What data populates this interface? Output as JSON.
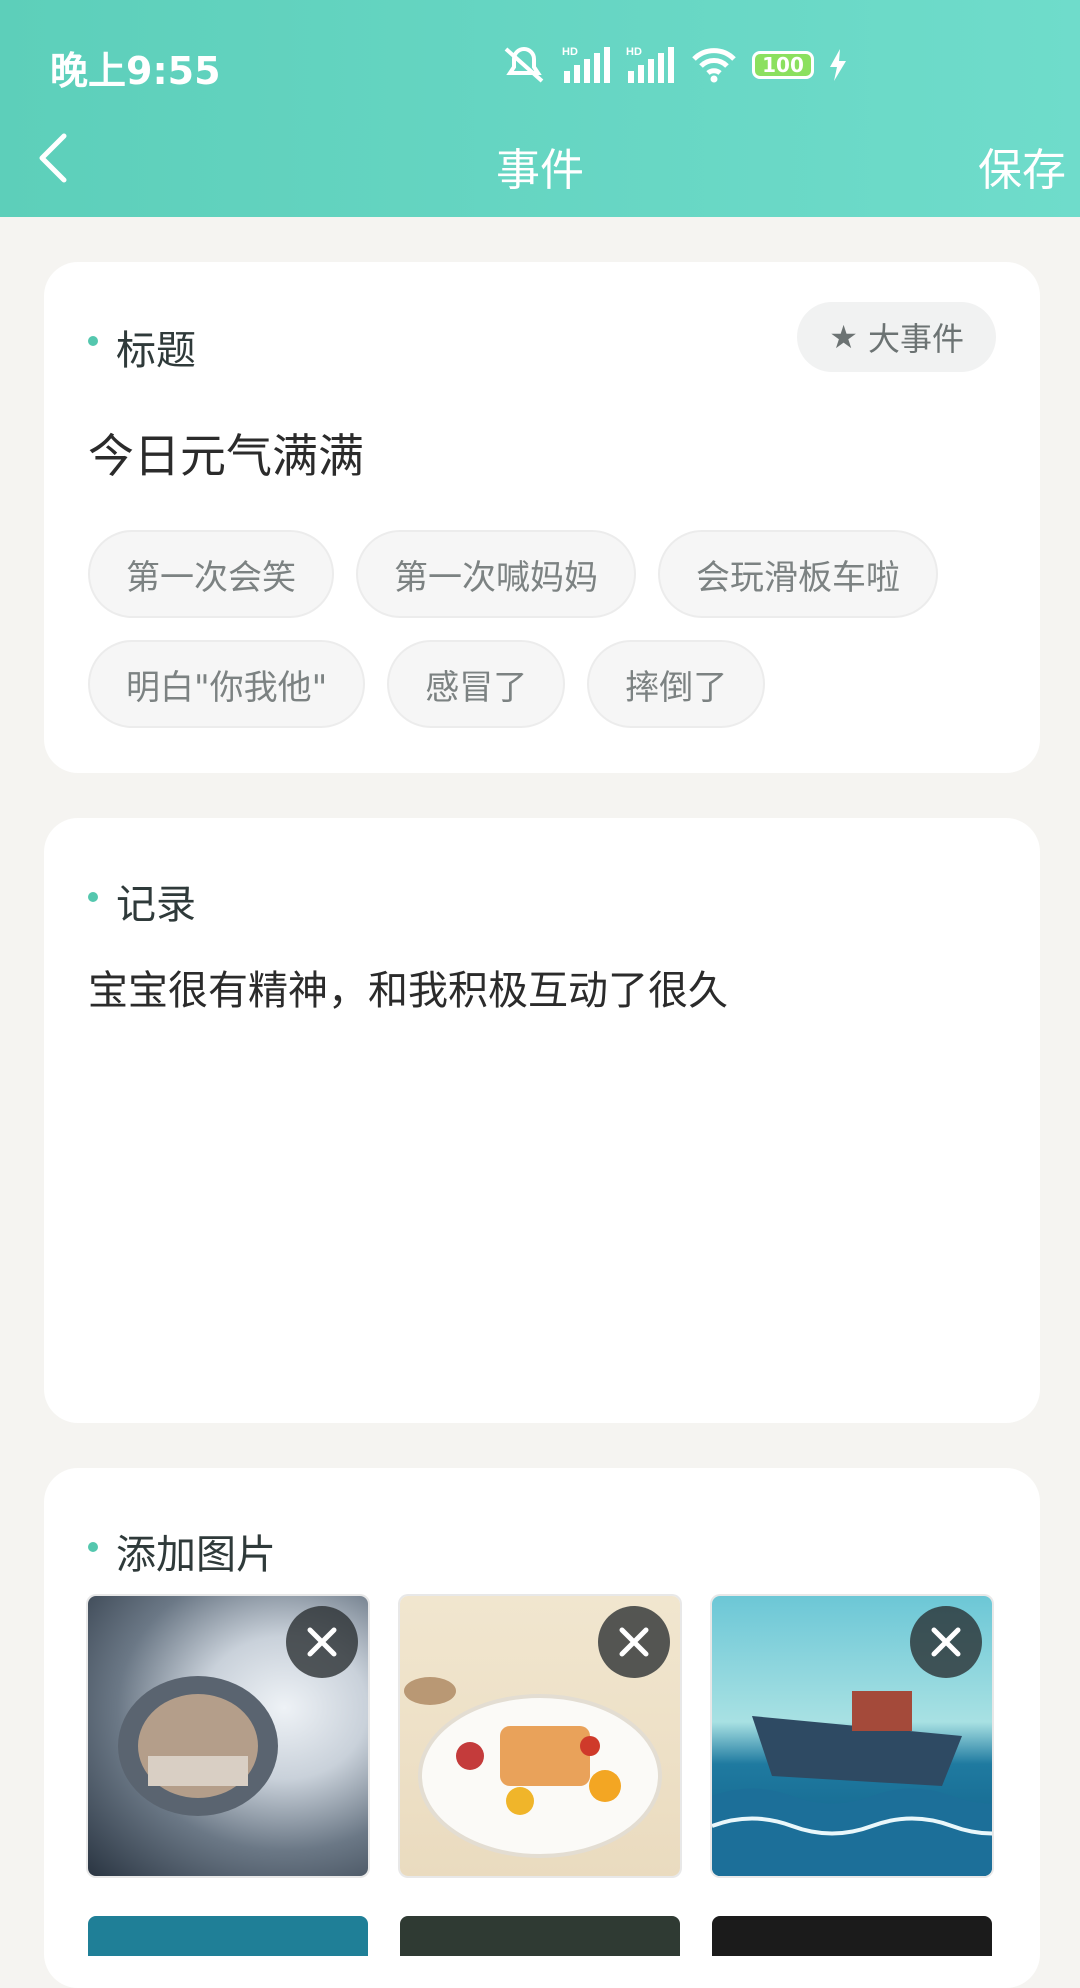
{
  "status_bar": {
    "time": "晚上9:55",
    "battery": "100",
    "icons": [
      "mute-icon",
      "hd-signal-icon",
      "hd-signal-icon",
      "wifi-icon",
      "battery-icon",
      "charging-icon"
    ]
  },
  "header": {
    "title": "事件",
    "save_label": "保存",
    "back_icon": "chevron-left-icon"
  },
  "title_section": {
    "label": "标题",
    "big_event_label": "大事件",
    "value": "今日元气满满",
    "tags": [
      "第一次会笑",
      "第一次喊妈妈",
      "会玩滑板车啦",
      "明白\"你我他\"",
      "感冒了",
      "摔倒了"
    ]
  },
  "record_section": {
    "label": "记录",
    "text": "宝宝很有精神，和我积极互动了很久"
  },
  "photo_section": {
    "label": "添加图片",
    "photos": [
      "capsule-pod-image",
      "breakfast-plate-image",
      "fishing-boat-image"
    ]
  },
  "colors": {
    "accent": "#5dcfba",
    "card_bg": "#ffffff",
    "page_bg": "#f5f4f1"
  }
}
